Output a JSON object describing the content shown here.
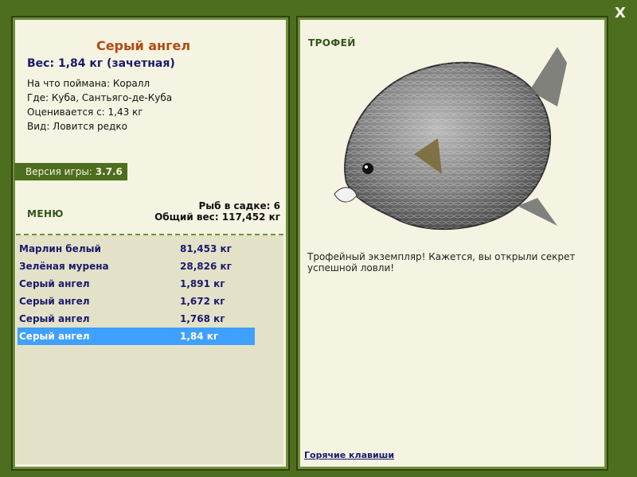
{
  "header": {
    "close_label": "X"
  },
  "fish": {
    "name": "Серый ангел",
    "weight_line": "Вес: 1,84 кг (зачетная)",
    "caught_on": "На что поймана: Коралл",
    "where": "Где: Куба, Сантьяго-де-Куба",
    "value": "Оценивается с: 1,43 кг",
    "kind": "Вид: Ловится редко"
  },
  "version": {
    "label": "Версия игры: ",
    "value": "3.7.6"
  },
  "menu": {
    "label": "МЕНЮ"
  },
  "cage": {
    "count": "Рыб в садке: 6",
    "total_weight": "Общий вес: 117,452 кг"
  },
  "catch_list": [
    {
      "name": "Марлин белый",
      "weight": "81,453 кг"
    },
    {
      "name": "Зелёная мурена",
      "weight": "28,826 кг"
    },
    {
      "name": "Серый ангел",
      "weight": "1,891 кг"
    },
    {
      "name": "Серый ангел",
      "weight": "1,672 кг"
    },
    {
      "name": "Серый ангел",
      "weight": "1,768 кг"
    },
    {
      "name": "Серый ангел",
      "weight": "1,84 кг"
    }
  ],
  "trophy": {
    "title": "ТРОФЕЙ",
    "text": "Трофейный экземпляр! Кажется, вы открыли секрет успешной ловли!"
  },
  "footer": {
    "hotkeys_link": "Горячие клавиши"
  },
  "colors": {
    "background": "#4e6e1f",
    "panel": "#f5f4e2",
    "accent_title": "#b24a12",
    "list_text": "#1a1a6a",
    "selected_row": "#3fa0ff"
  }
}
